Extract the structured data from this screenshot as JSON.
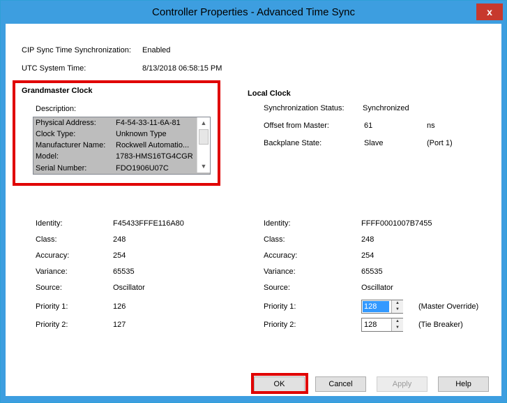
{
  "window": {
    "title": "Controller Properties - Advanced Time Sync",
    "close_label": "x"
  },
  "cip": {
    "label": "CIP Sync Time Synchronization:",
    "value": "Enabled"
  },
  "utc": {
    "label": "UTC System Time:",
    "value": "8/13/2018 06:58:15 PM"
  },
  "grandmaster": {
    "heading": "Grandmaster Clock",
    "description_label": "Description:",
    "rows": [
      {
        "key": "Physical Address:",
        "value": "F4-54-33-11-6A-81"
      },
      {
        "key": "Clock Type:",
        "value": "Unknown Type"
      },
      {
        "key": "Manufacturer Name:",
        "value": "Rockwell Automatio..."
      },
      {
        "key": "Model:",
        "value": "1783-HMS16TG4CGR"
      },
      {
        "key": "Serial Number:",
        "value": "FDO1906U07C"
      }
    ]
  },
  "local": {
    "heading": "Local Clock",
    "sync_label": "Synchronization Status:",
    "sync_value": "Synchronized",
    "offset_label": "Offset from Master:",
    "offset_value": "61",
    "offset_unit": "ns",
    "backplane_label": "Backplane State:",
    "backplane_value": "Slave",
    "backplane_port": "(Port 1)"
  },
  "left_props": {
    "identity_label": "Identity:",
    "identity": "F45433FFFE116A80",
    "class_label": "Class:",
    "class": "248",
    "accuracy_label": "Accuracy:",
    "accuracy": "254",
    "variance_label": "Variance:",
    "variance": "65535",
    "source_label": "Source:",
    "source": "Oscillator",
    "p1_label": "Priority 1:",
    "p1": "126",
    "p2_label": "Priority 2:",
    "p2": "127"
  },
  "right_props": {
    "identity_label": "Identity:",
    "identity": "FFFF0001007B7455",
    "class_label": "Class:",
    "class": "248",
    "accuracy_label": "Accuracy:",
    "accuracy": "254",
    "variance_label": "Variance:",
    "variance": "65535",
    "source_label": "Source:",
    "source": "Oscillator",
    "p1_label": "Priority 1:",
    "p1": "128",
    "p1_note": "(Master Override)",
    "p2_label": "Priority 2:",
    "p2": "128",
    "p2_note": "(Tie Breaker)"
  },
  "buttons": {
    "ok": "OK",
    "cancel": "Cancel",
    "apply": "Apply",
    "help": "Help"
  },
  "colors": {
    "titlebar": "#3d9ee0",
    "close": "#c7392d",
    "highlight": "#e00000"
  }
}
